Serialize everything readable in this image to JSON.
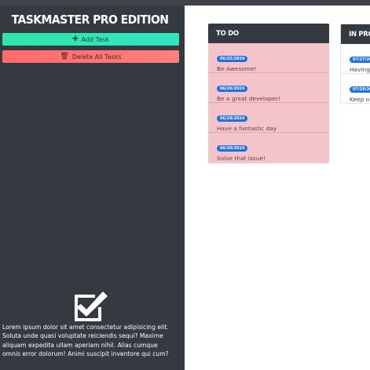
{
  "sidebar": {
    "app_title": "TASKMASTER PRO EDITION",
    "add_task_label": "Add Task",
    "delete_all_label": "Delete All Tasks",
    "description": "Lorem ipsum dolor sit amet consectetur adipisicing elit. Soluta unde quasi voluptate reiciendis sequi? Maxime aliquam expedita ullam aperiam nihil. Alias cumque omnis error dolorum! Animi suscipit inventore qui cum?"
  },
  "columns": {
    "todo": {
      "title": "TO DO",
      "tasks": [
        {
          "date": "06/25/2024",
          "text": "Be Awesome!"
        },
        {
          "date": "06/26/2024",
          "text": "Be a great developer!"
        },
        {
          "date": "06/28/2024",
          "text": "Have a fantastic day"
        },
        {
          "date": "06/30/2024",
          "text": "Solve that issue!"
        }
      ]
    },
    "in_progress": {
      "title": "IN PROG",
      "tasks": [
        {
          "date": "07/27/20",
          "text": "Having"
        },
        {
          "date": "07/28/20",
          "text": "Keep o"
        }
      ]
    }
  },
  "colors": {
    "sidebar_bg": "#343a40",
    "add_button": "#2ee6a8",
    "delete_button": "#ff6b6b",
    "todo_card": "#f4c4cb",
    "badge": "#1f6fe5"
  },
  "icons": {
    "add": "plus-icon",
    "delete": "trash-icon",
    "logo": "checkbox-checked-icon"
  }
}
